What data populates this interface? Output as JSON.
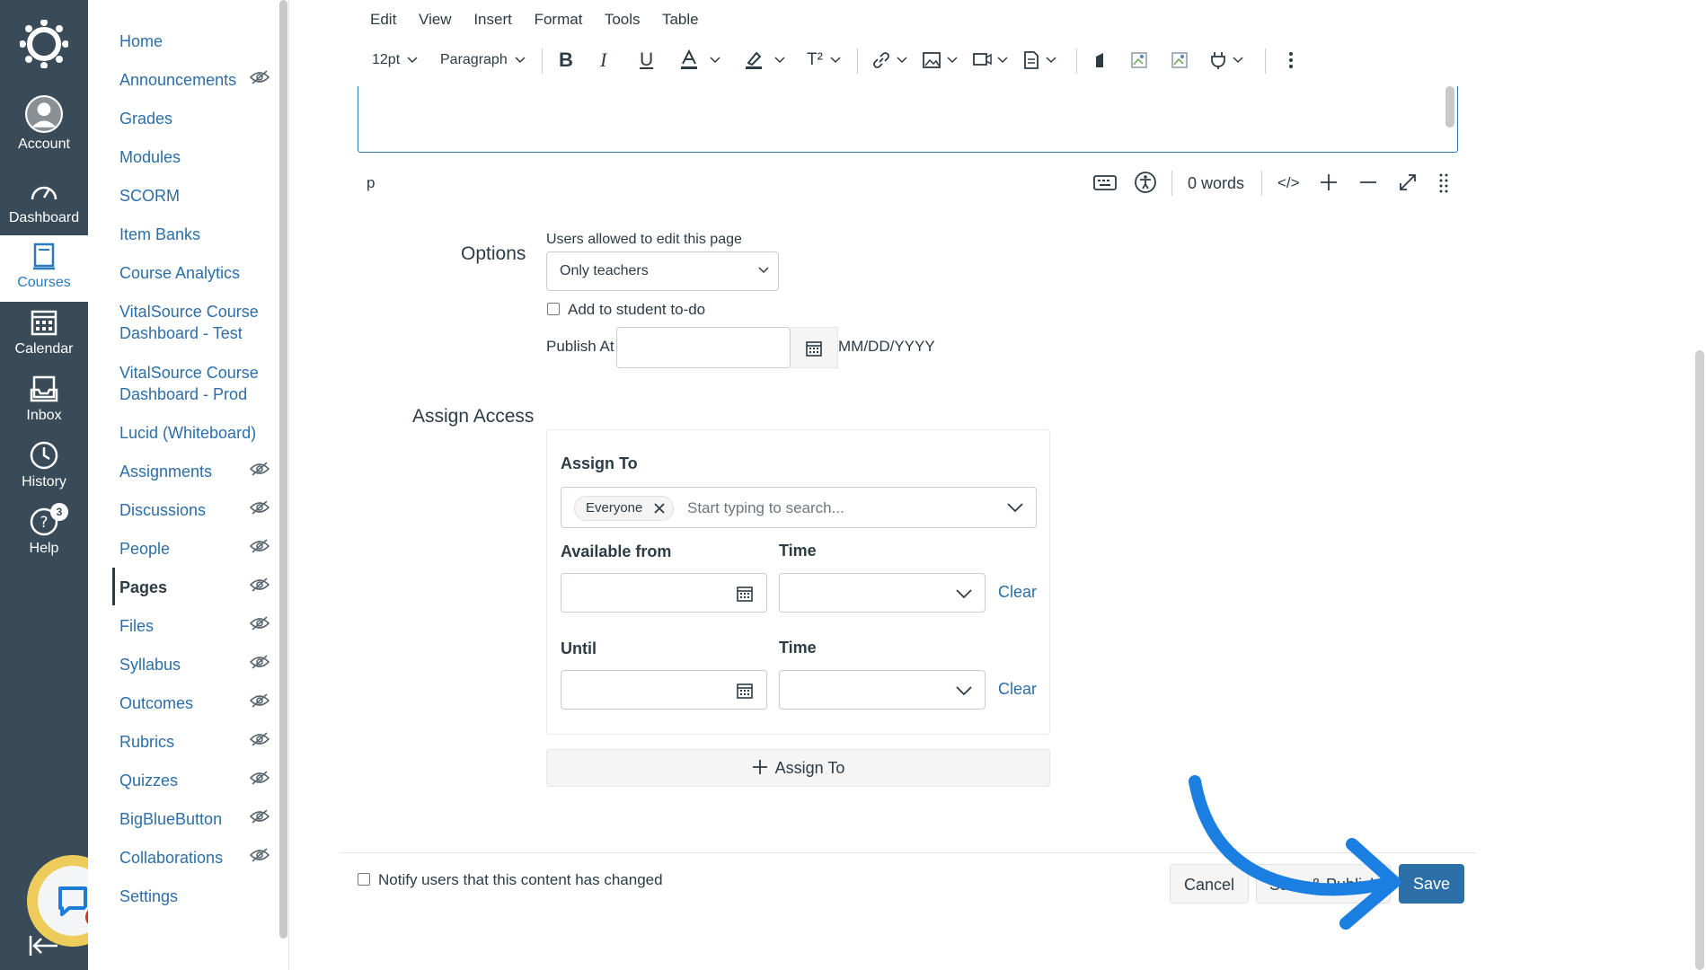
{
  "global_nav": {
    "items": [
      {
        "label": "Account",
        "icon": "account-avatar-icon"
      },
      {
        "label": "Dashboard",
        "icon": "dashboard-icon"
      },
      {
        "label": "Courses",
        "icon": "courses-icon",
        "active": true
      },
      {
        "label": "Calendar",
        "icon": "calendar-icon"
      },
      {
        "label": "Inbox",
        "icon": "inbox-icon"
      },
      {
        "label": "History",
        "icon": "history-clock-icon"
      },
      {
        "label": "Help",
        "icon": "help-icon"
      }
    ],
    "help_badge": "3"
  },
  "course_nav": {
    "items": [
      {
        "label": "Home"
      },
      {
        "label": "Announcements",
        "hidden": true
      },
      {
        "label": "Grades"
      },
      {
        "label": "Modules"
      },
      {
        "label": "SCORM"
      },
      {
        "label": "Item Banks"
      },
      {
        "label": "Course Analytics"
      },
      {
        "label": "VitalSource Course Dashboard - Test"
      },
      {
        "label": "VitalSource Course Dashboard - Prod"
      },
      {
        "label": "Lucid (Whiteboard)"
      },
      {
        "label": "Assignments",
        "hidden": true
      },
      {
        "label": "Discussions",
        "hidden": true
      },
      {
        "label": "People",
        "hidden": true
      },
      {
        "label": "Pages",
        "hidden": true,
        "active": true
      },
      {
        "label": "Files",
        "hidden": true
      },
      {
        "label": "Syllabus",
        "hidden": true
      },
      {
        "label": "Outcomes",
        "hidden": true
      },
      {
        "label": "Rubrics",
        "hidden": true
      },
      {
        "label": "Quizzes",
        "hidden": true
      },
      {
        "label": "BigBlueButton",
        "hidden": true
      },
      {
        "label": "Collaborations",
        "hidden": true
      },
      {
        "label": "Settings"
      }
    ]
  },
  "editor": {
    "menu": [
      "Edit",
      "View",
      "Insert",
      "Format",
      "Tools",
      "Table"
    ],
    "font_size": "12pt",
    "block_format": "Paragraph",
    "superscript_label": "T²",
    "status_path": "p",
    "word_count": "0 words",
    "html_toggle": "</>"
  },
  "options": {
    "section_label": "Options",
    "edit_label": "Users allowed to edit this page",
    "edit_value": "Only teachers",
    "todo_label": "Add to student to-do",
    "publish_label": "Publish At",
    "publish_format": "MM/DD/YYYY"
  },
  "assign_access": {
    "section_label": "Assign Access",
    "assign_to_label": "Assign To",
    "tag": "Everyone",
    "search_placeholder": "Start typing to search...",
    "available_from_label": "Available from",
    "time_label": "Time",
    "until_label": "Until",
    "clear_label": "Clear",
    "add_button": "Assign To"
  },
  "footer": {
    "notify_label": "Notify users that this content has changed",
    "cancel": "Cancel",
    "save_publish": "Save & Publish",
    "save": "Save"
  },
  "colors": {
    "nav_bg": "#394b58",
    "link": "#2b6ea8",
    "primary": "#2b6ea8",
    "arrow": "#1a7fe0"
  }
}
